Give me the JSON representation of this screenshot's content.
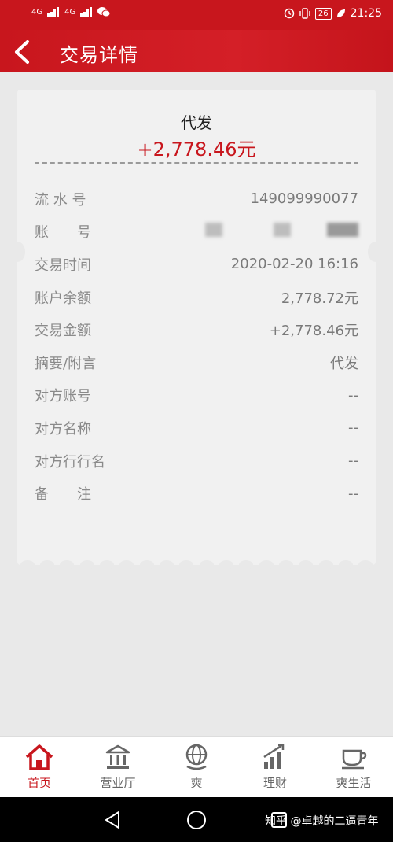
{
  "status": {
    "time": "21:25",
    "battery": "26",
    "network1": "4G",
    "network2": "4G"
  },
  "header": {
    "title": "交易详情"
  },
  "receipt": {
    "type": "代发",
    "amount": "+2,778.46元",
    "rows": [
      {
        "label": "流 水 号",
        "value": "149099990077"
      },
      {
        "label": "账　　号",
        "value": ""
      },
      {
        "label": "交易时间",
        "value": "2020-02-20 16:16"
      },
      {
        "label": "账户余额",
        "value": "2,778.72元"
      },
      {
        "label": "交易金额",
        "value": "+2,778.46元"
      },
      {
        "label": "摘要/附言",
        "value": "代发"
      },
      {
        "label": "对方账号",
        "value": "--"
      },
      {
        "label": "对方名称",
        "value": "--"
      },
      {
        "label": "对方行行名",
        "value": "--"
      },
      {
        "label": "备　　注",
        "value": "--"
      }
    ]
  },
  "tabs": [
    {
      "label": "首页",
      "icon": "home-icon",
      "active": true
    },
    {
      "label": "营业厅",
      "icon": "bank-icon",
      "active": false
    },
    {
      "label": "爽",
      "icon": "globe-icon",
      "active": false
    },
    {
      "label": "理财",
      "icon": "chart-up-icon",
      "active": false
    },
    {
      "label": "爽生活",
      "icon": "coffee-cup-icon",
      "active": false
    }
  ],
  "watermark": "知乎 @卓越的二逼青年",
  "colors": {
    "brand": "#c8161d",
    "background": "#e9e9e9",
    "card": "#f1f1f1"
  }
}
